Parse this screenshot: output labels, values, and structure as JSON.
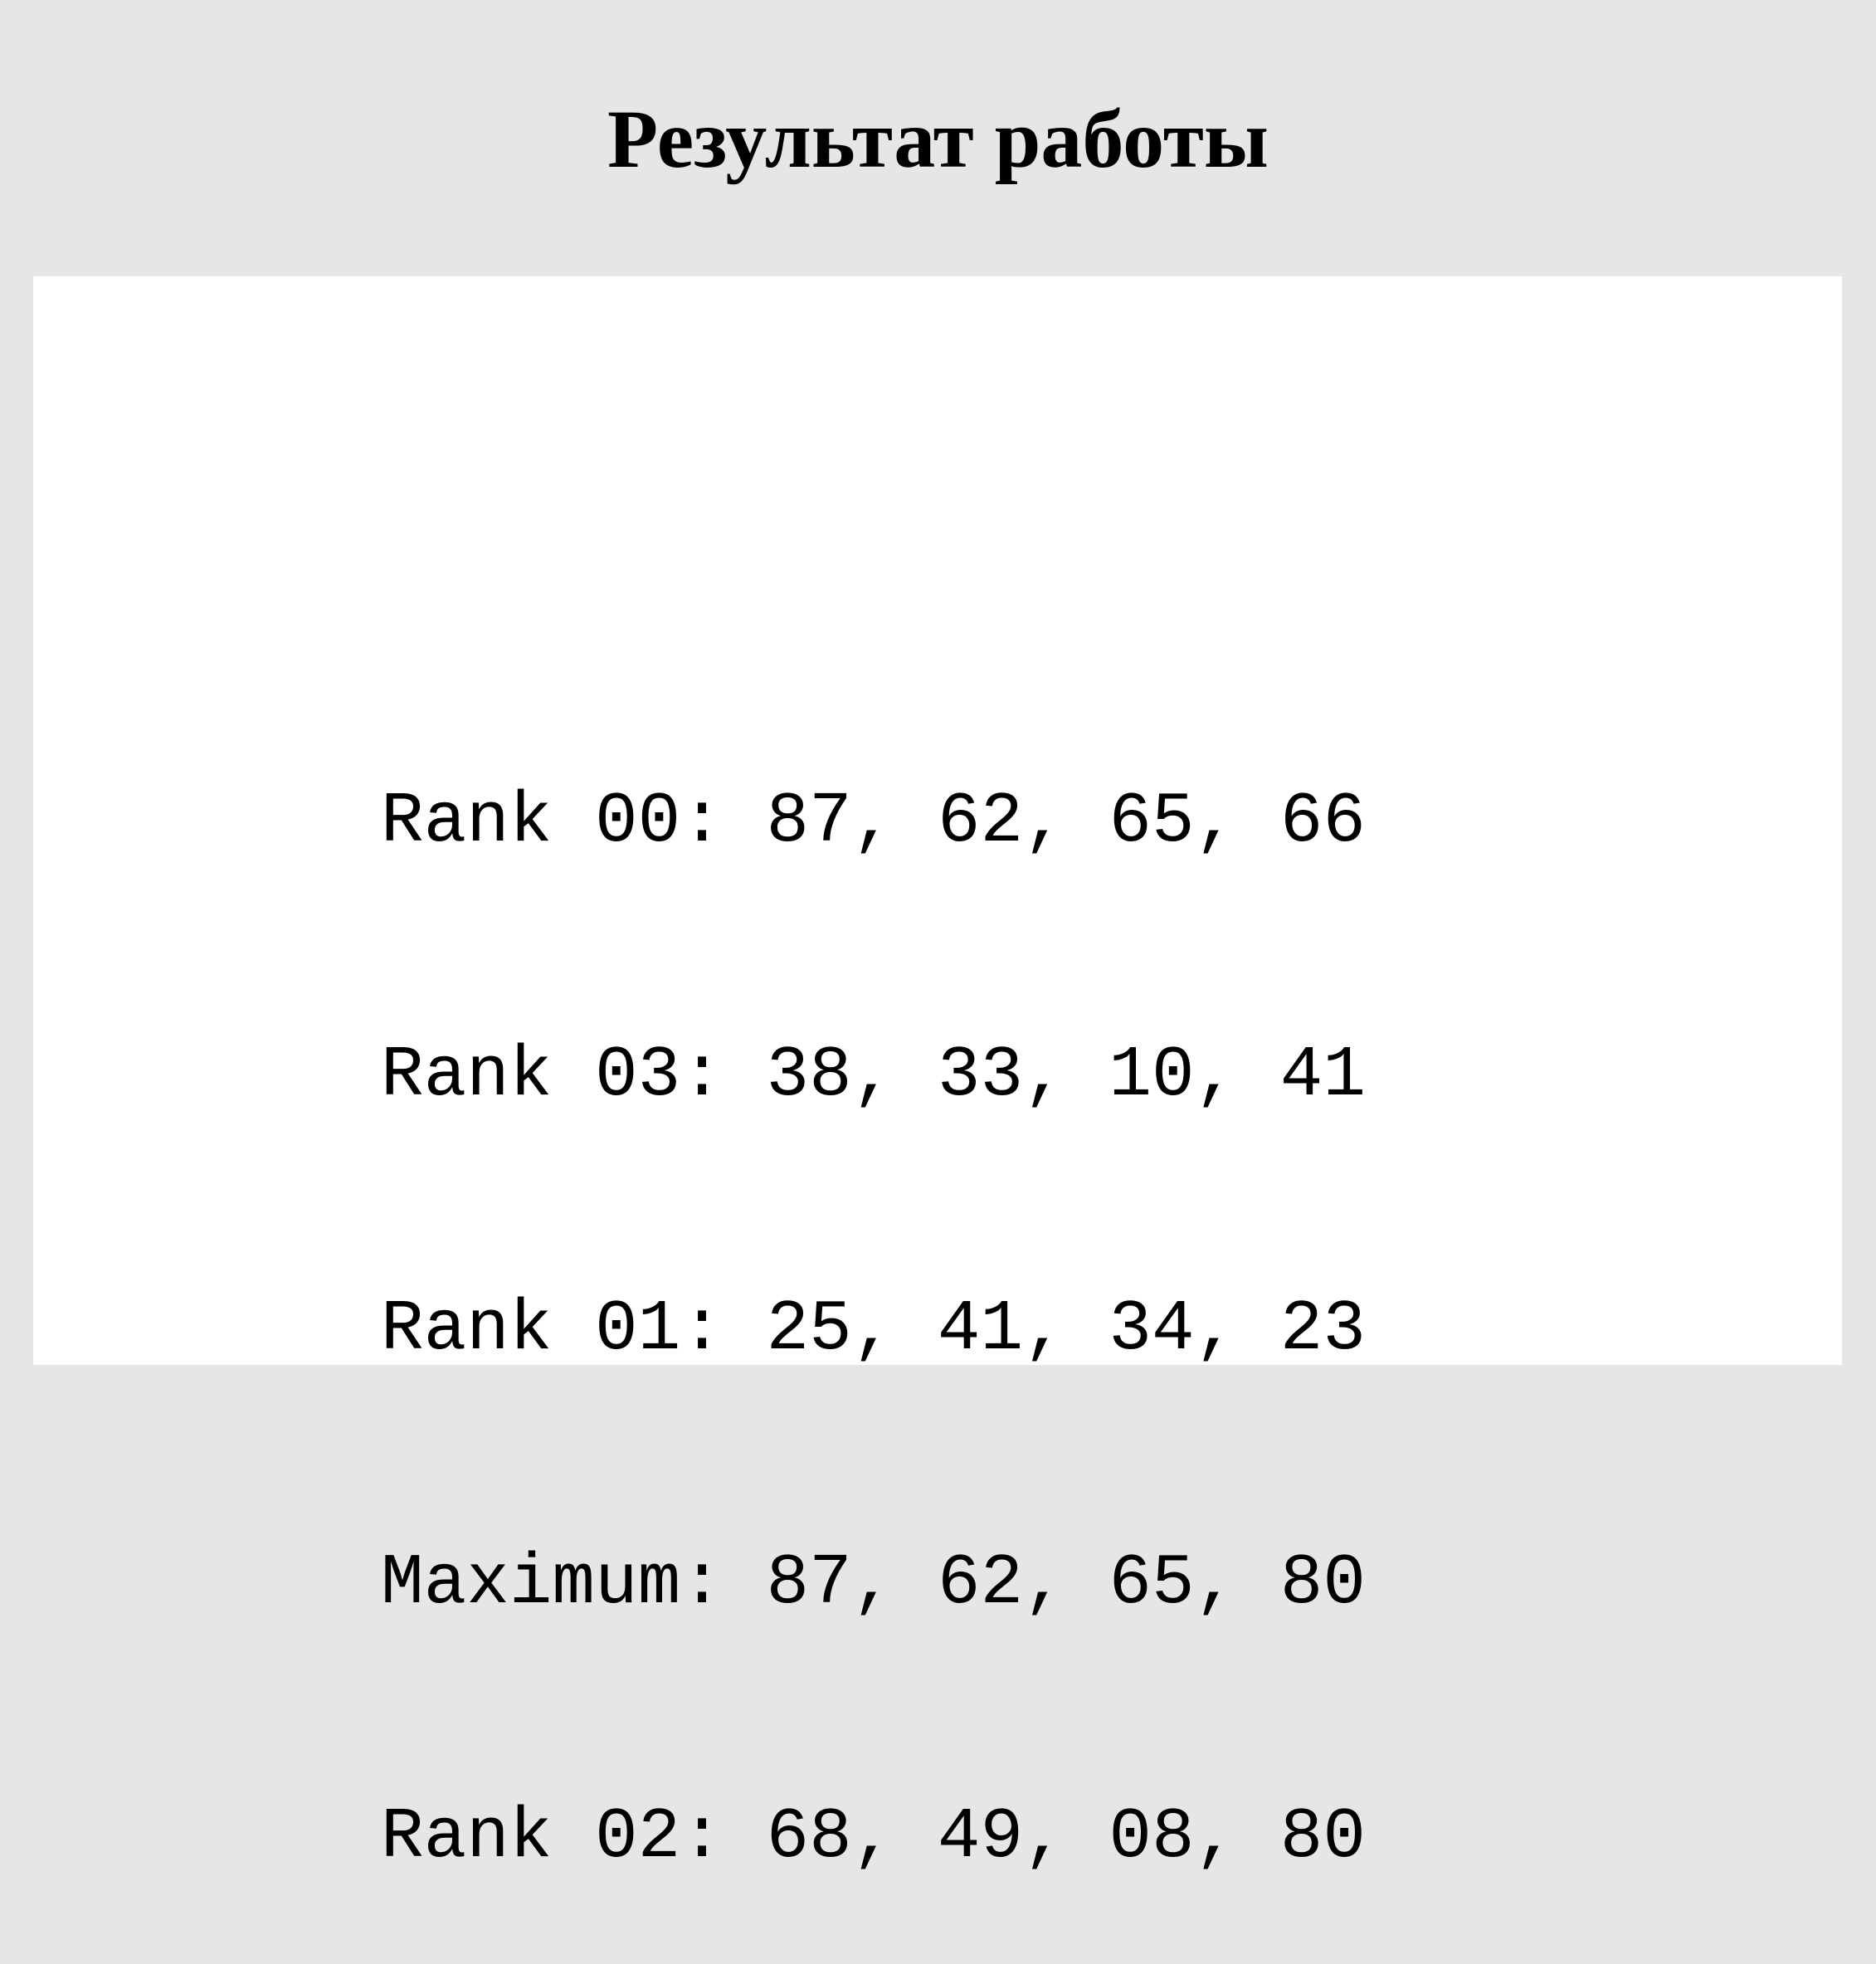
{
  "slide": {
    "title": "Результат работы"
  },
  "output": {
    "lines": [
      "Rank 00: 87, 62, 65, 66",
      "Rank 03: 38, 33, 10, 41",
      "Rank 01: 25, 41, 34, 23",
      "Maximum: 87, 62, 65, 80",
      "Rank 02: 68, 49, 08, 80"
    ]
  }
}
